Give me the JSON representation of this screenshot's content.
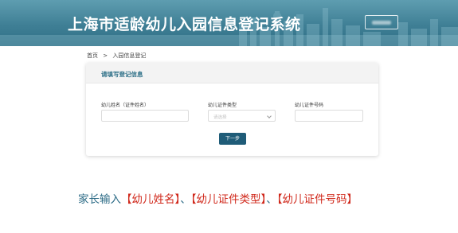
{
  "header": {
    "title": "上海市适龄幼儿入园信息登记系统",
    "user_chip_text": ""
  },
  "breadcrumb": {
    "home": "首页",
    "separator": ">",
    "current": "入园信息登记"
  },
  "form": {
    "title": "请填写登记信息",
    "name_label": "幼儿姓名（证件姓名）",
    "name_value": "",
    "id_type_label": "幼儿证件类型",
    "id_type_placeholder": "请选择",
    "id_number_label": "幼儿证件号码",
    "id_number_value": "",
    "next_label": "下一步"
  },
  "instruction": {
    "prefix": "家长输入",
    "item1": "【幼儿姓名】",
    "sep1": "、",
    "item2": "【幼儿证件类型】",
    "sep2": "、",
    "item3": "【幼儿证件号码】"
  },
  "colors": {
    "header": "#3f7f95",
    "accent": "#1f5c78",
    "highlight": "#d0281b",
    "instruction_text": "#2a6a85"
  }
}
